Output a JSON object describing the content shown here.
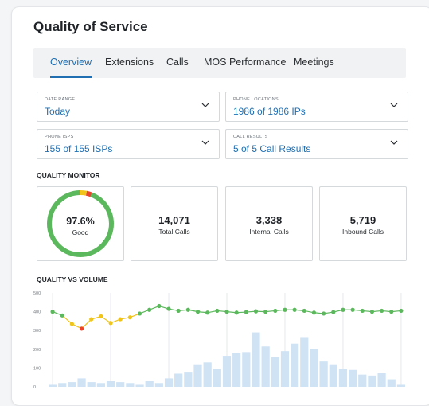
{
  "page": {
    "title": "Quality of Service"
  },
  "tabs": [
    {
      "label": "Overview",
      "active": true
    },
    {
      "label": "Extensions"
    },
    {
      "label": "Calls"
    },
    {
      "label": "MOS Performance"
    },
    {
      "label": "Meetings"
    }
  ],
  "filters": {
    "date_range": {
      "label": "DATE RANGE",
      "value": "Today"
    },
    "phone_locations": {
      "label": "PHONE LOCATIONS",
      "value": "1986 of 1986 IPs"
    },
    "phone_isps": {
      "label": "PHONE ISPS",
      "value": "155 of 155 ISPs"
    },
    "call_results": {
      "label": "CALL RESULTS",
      "value": "5 of 5 Call Results"
    }
  },
  "quality_monitor": {
    "label": "QUALITY MONITOR",
    "gauge": {
      "percent": "97.6%",
      "status": "Good",
      "good_fraction": 0.94,
      "warn_fraction": 0.035,
      "bad_fraction": 0.025,
      "colors": {
        "good": "#5cb85c",
        "warn": "#f0c419",
        "bad": "#e8452c"
      }
    },
    "stats": [
      {
        "value": "14,071",
        "label": "Total Calls"
      },
      {
        "value": "3,338",
        "label": "Internal Calls"
      },
      {
        "value": "5,719",
        "label": "Inbound Calls"
      }
    ]
  },
  "chart_data": {
    "type": "bar",
    "title": "QUALITY VS VOLUME",
    "ylim": [
      0,
      500
    ],
    "y_ticks": [
      "0",
      "100",
      "200",
      "300",
      "400",
      "500"
    ],
    "grid": true,
    "bars": {
      "color": "#cfe3f5",
      "values": [
        15,
        20,
        25,
        45,
        25,
        20,
        30,
        25,
        20,
        15,
        30,
        20,
        45,
        70,
        80,
        120,
        130,
        95,
        165,
        180,
        185,
        290,
        215,
        160,
        190,
        230,
        265,
        200,
        135,
        120,
        95,
        90,
        65,
        60,
        75,
        40,
        15
      ]
    },
    "line": {
      "values": [
        400,
        380,
        335,
        310,
        360,
        375,
        340,
        360,
        370,
        390,
        410,
        430,
        415,
        405,
        410,
        400,
        395,
        405,
        400,
        395,
        398,
        402,
        400,
        405,
        410,
        410,
        405,
        395,
        390,
        398,
        410,
        410,
        405,
        400,
        405,
        400,
        405
      ],
      "colors": {
        "good": "#5cb85c",
        "warn": "#f0c419",
        "bad": "#e8452c"
      }
    }
  }
}
